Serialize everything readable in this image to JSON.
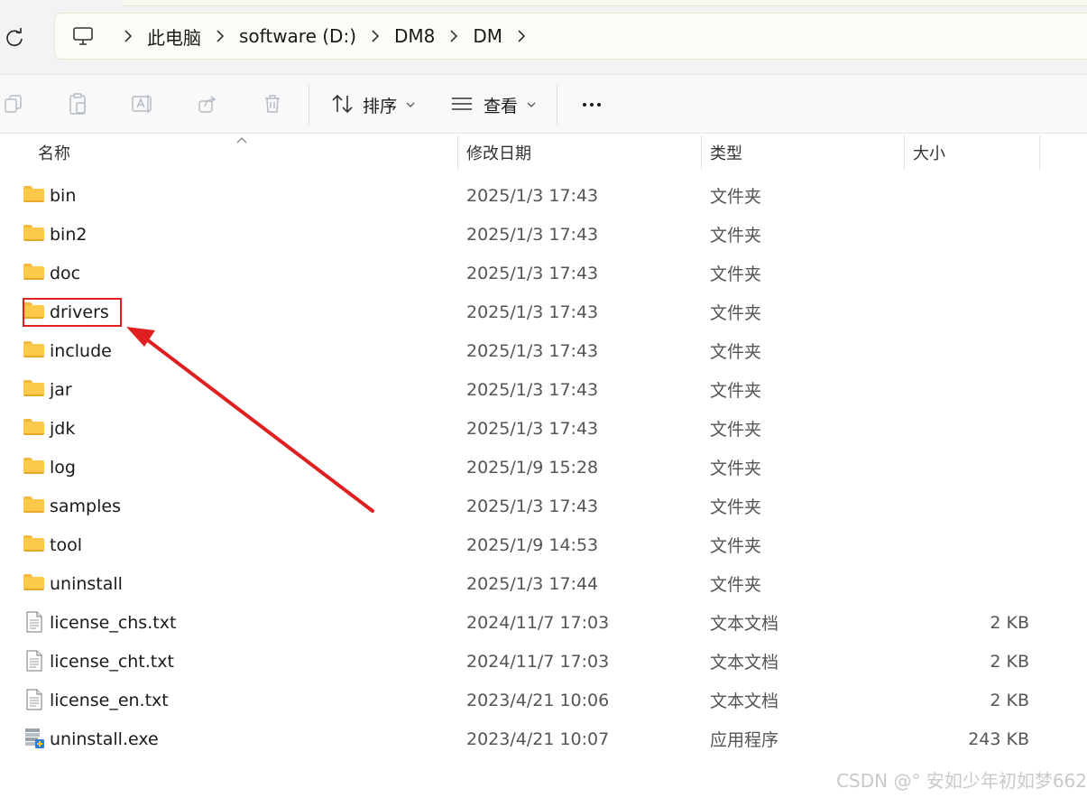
{
  "address_bar": {
    "root_icon": "computer-icon",
    "breadcrumbs": [
      "此电脑",
      "software (D:)",
      "DM8",
      "DM"
    ]
  },
  "toolbar": {
    "sort_label": "排序",
    "view_label": "查看"
  },
  "columns": {
    "name": "名称",
    "date": "修改日期",
    "type": "类型",
    "size": "大小"
  },
  "files": [
    {
      "name": "bin",
      "date": "2025/1/3 17:43",
      "type": "文件夹",
      "size": "",
      "icon": "folder-icon"
    },
    {
      "name": "bin2",
      "date": "2025/1/3 17:43",
      "type": "文件夹",
      "size": "",
      "icon": "folder-icon"
    },
    {
      "name": "doc",
      "date": "2025/1/3 17:43",
      "type": "文件夹",
      "size": "",
      "icon": "folder-icon"
    },
    {
      "name": "drivers",
      "date": "2025/1/3 17:43",
      "type": "文件夹",
      "size": "",
      "icon": "folder-icon"
    },
    {
      "name": "include",
      "date": "2025/1/3 17:43",
      "type": "文件夹",
      "size": "",
      "icon": "folder-icon"
    },
    {
      "name": "jar",
      "date": "2025/1/3 17:43",
      "type": "文件夹",
      "size": "",
      "icon": "folder-icon"
    },
    {
      "name": "jdk",
      "date": "2025/1/3 17:43",
      "type": "文件夹",
      "size": "",
      "icon": "folder-icon"
    },
    {
      "name": "log",
      "date": "2025/1/9 15:28",
      "type": "文件夹",
      "size": "",
      "icon": "folder-icon"
    },
    {
      "name": "samples",
      "date": "2025/1/3 17:43",
      "type": "文件夹",
      "size": "",
      "icon": "folder-icon"
    },
    {
      "name": "tool",
      "date": "2025/1/9 14:53",
      "type": "文件夹",
      "size": "",
      "icon": "folder-icon"
    },
    {
      "name": "uninstall",
      "date": "2025/1/3 17:44",
      "type": "文件夹",
      "size": "",
      "icon": "folder-icon"
    },
    {
      "name": "license_chs.txt",
      "date": "2024/11/7 17:03",
      "type": "文本文档",
      "size": "2 KB",
      "icon": "text-file-icon"
    },
    {
      "name": "license_cht.txt",
      "date": "2024/11/7 17:03",
      "type": "文本文档",
      "size": "2 KB",
      "icon": "text-file-icon"
    },
    {
      "name": "license_en.txt",
      "date": "2023/4/21 10:06",
      "type": "文本文档",
      "size": "2 KB",
      "icon": "text-file-icon"
    },
    {
      "name": "uninstall.exe",
      "date": "2023/4/21 10:07",
      "type": "应用程序",
      "size": "243 KB",
      "icon": "exe-file-icon"
    }
  ],
  "annotation": {
    "highlight_color": "#e02020",
    "highlighted_item": "drivers"
  },
  "watermark": "CSDN @° 安如少年初如梦662"
}
